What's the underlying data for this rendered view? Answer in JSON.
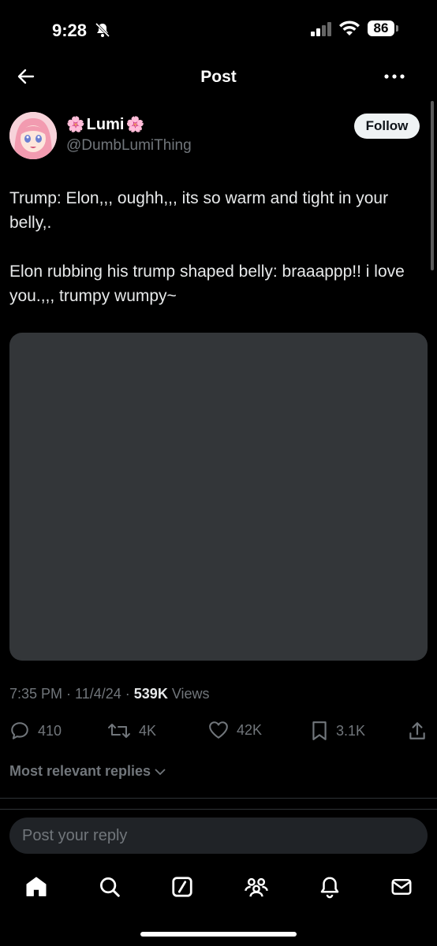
{
  "status_bar": {
    "time": "9:28",
    "battery": "86"
  },
  "header": {
    "title": "Post"
  },
  "author": {
    "display_name": "Lumi",
    "emoji_left": "🌸",
    "emoji_right": "🌸",
    "handle": "@DumbLumiThing",
    "follow_label": "Follow"
  },
  "post": {
    "paragraphs": [
      "Trump: Elon,,, oughh,,, its so warm and tight in your belly,.",
      "Elon rubbing his trump shaped belly: braaappp!! i love you.,,, trumpy wumpy~"
    ],
    "time": "7:35 PM",
    "date": "11/4/24",
    "views_count": "539K",
    "views_label": "Views"
  },
  "actions": {
    "replies": "410",
    "reposts": "4K",
    "likes": "42K",
    "bookmarks": "3.1K"
  },
  "replies_sort": "Most relevant replies",
  "reply_input": {
    "placeholder": "Post your reply"
  },
  "colors": {
    "background": "#000000",
    "text": "#e7e9ea",
    "muted": "#71767b",
    "media_placeholder": "#333639"
  }
}
